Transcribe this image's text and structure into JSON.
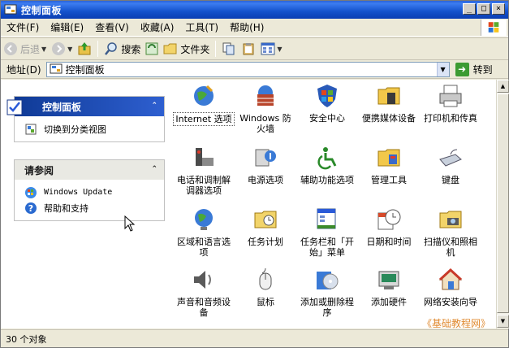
{
  "window": {
    "title": "控制面板",
    "buttons": {
      "minimize": "_",
      "maximize": "□",
      "close": "×"
    }
  },
  "menu": [
    "文件(F)",
    "编辑(E)",
    "查看(V)",
    "收藏(A)",
    "工具(T)",
    "帮助(H)"
  ],
  "toolbar": {
    "back": "后退",
    "search": "搜索",
    "folders": "文件夹"
  },
  "address": {
    "label": "地址(D)",
    "value": "控制面板",
    "go": "转到"
  },
  "leftpane": {
    "panel1": {
      "title": "控制面板",
      "link": "切换到分类视图"
    },
    "panel2": {
      "title": "请参阅",
      "links": [
        "Windows Update",
        "帮助和支持"
      ]
    }
  },
  "items": [
    "Internet 选项",
    "Windows 防火墙",
    "安全中心",
    "便携媒体设备",
    "打印机和传真",
    "电话和调制解调器选项",
    "电源选项",
    "辅助功能选项",
    "管理工具",
    "键盘",
    "区域和语言选项",
    "任务计划",
    "任务栏和「开始」菜单",
    "日期和时间",
    "扫描仪和照相机",
    "声音和音频设备",
    "鼠标",
    "添加或删除程序",
    "添加硬件",
    "网络安装向导"
  ],
  "status": {
    "text": "30 个对象"
  },
  "watermark": "《基础教程网》",
  "colors": {
    "titlebar": "#1452cc",
    "panel_header": "#0f3a96",
    "window_bg": "#ECE9D8"
  }
}
